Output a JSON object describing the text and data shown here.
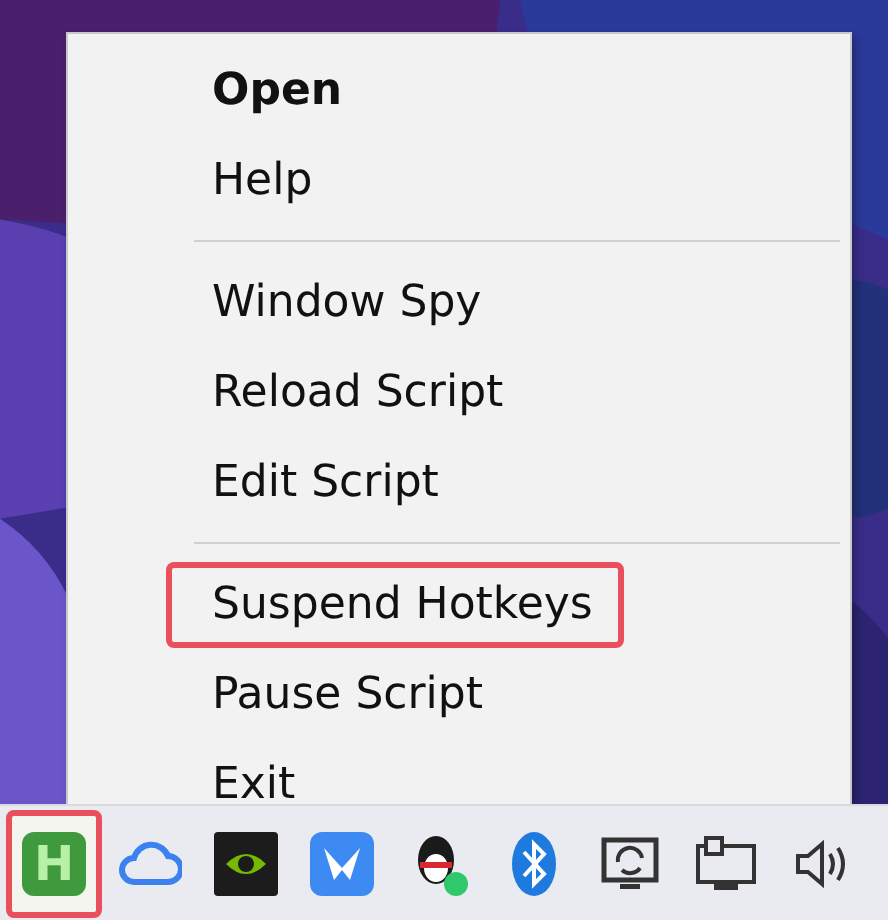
{
  "context_menu": {
    "items": [
      {
        "kind": "item",
        "label": "Open",
        "default": true,
        "highlighted": false
      },
      {
        "kind": "item",
        "label": "Help",
        "default": false,
        "highlighted": false
      },
      {
        "kind": "separator"
      },
      {
        "kind": "item",
        "label": "Window Spy",
        "default": false,
        "highlighted": false
      },
      {
        "kind": "item",
        "label": "Reload Script",
        "default": false,
        "highlighted": false
      },
      {
        "kind": "item",
        "label": "Edit Script",
        "default": false,
        "highlighted": false
      },
      {
        "kind": "separator"
      },
      {
        "kind": "item",
        "label": "Suspend Hotkeys",
        "default": false,
        "highlighted": true
      },
      {
        "kind": "item",
        "label": "Pause Script",
        "default": false,
        "highlighted": false
      },
      {
        "kind": "item",
        "label": "Exit",
        "default": false,
        "highlighted": false
      }
    ]
  },
  "taskbar": {
    "tray_icons": [
      {
        "kind": "letter",
        "label": "H",
        "highlighted": true
      },
      {
        "kind": "cloud",
        "highlighted": false
      },
      {
        "kind": "chip",
        "highlighted": false
      },
      {
        "kind": "bird",
        "highlighted": false
      },
      {
        "kind": "penguin",
        "highlighted": false
      },
      {
        "kind": "bluetooth",
        "highlighted": false
      },
      {
        "kind": "display",
        "highlighted": false
      },
      {
        "kind": "network",
        "highlighted": false
      },
      {
        "kind": "speaker",
        "highlighted": false
      }
    ]
  }
}
